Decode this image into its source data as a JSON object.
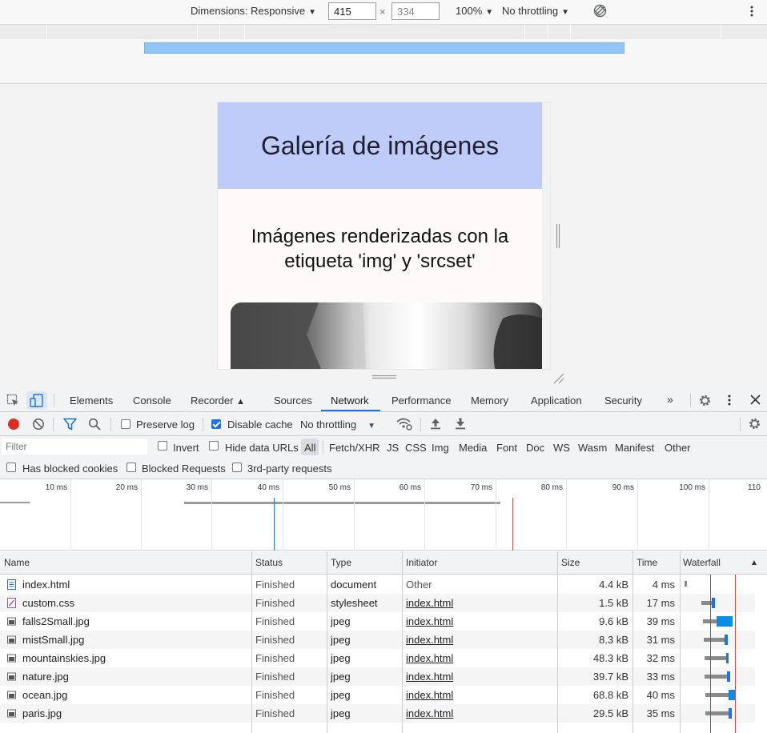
{
  "device_toolbar": {
    "dimensions_label": "Dimensions: Responsive",
    "width_value": "415",
    "height_value": "334",
    "zoom_label": "100%",
    "throttle_label": "No throttling"
  },
  "page": {
    "title": "Galería de imágenes",
    "subtitle": "Imágenes renderizadas con la etiqueta 'img' y 'srcset'"
  },
  "devtools": {
    "tabs": [
      "Elements",
      "Console",
      "Recorder",
      "Sources",
      "Network",
      "Performance",
      "Memory",
      "Application",
      "Security"
    ],
    "active_tab": "Network",
    "toolbar": {
      "preserve_log": "Preserve log",
      "disable_cache": "Disable cache",
      "throttling": "No throttling"
    },
    "filter": {
      "placeholder": "Filter",
      "invert": "Invert",
      "hide_data_urls": "Hide data URLs",
      "types": [
        "All",
        "Fetch/XHR",
        "JS",
        "CSS",
        "Img",
        "Media",
        "Font",
        "Doc",
        "WS",
        "Wasm",
        "Manifest",
        "Other"
      ],
      "has_blocked_cookies": "Has blocked cookies",
      "blocked_requests": "Blocked Requests",
      "third_party": "3rd-party requests"
    },
    "overview_ticks": [
      "10 ms",
      "20 ms",
      "30 ms",
      "40 ms",
      "50 ms",
      "60 ms",
      "70 ms",
      "80 ms",
      "90 ms",
      "100 ms",
      "110"
    ],
    "columns": [
      "Name",
      "Status",
      "Type",
      "Initiator",
      "Size",
      "Time",
      "Waterfall"
    ],
    "rows": [
      {
        "name": "index.html",
        "status": "Finished",
        "type": "document",
        "initiator": "Other",
        "size": "4.4 kB",
        "time": "4 ms"
      },
      {
        "name": "custom.css",
        "status": "Finished",
        "type": "stylesheet",
        "initiator": "index.html",
        "size": "1.5 kB",
        "time": "17 ms"
      },
      {
        "name": "falls2Small.jpg",
        "status": "Finished",
        "type": "jpeg",
        "initiator": "index.html",
        "size": "9.6 kB",
        "time": "39 ms"
      },
      {
        "name": "mistSmall.jpg",
        "status": "Finished",
        "type": "jpeg",
        "initiator": "index.html",
        "size": "8.3 kB",
        "time": "31 ms"
      },
      {
        "name": "mountainskies.jpg",
        "status": "Finished",
        "type": "jpeg",
        "initiator": "index.html",
        "size": "48.3 kB",
        "time": "32 ms"
      },
      {
        "name": "nature.jpg",
        "status": "Finished",
        "type": "jpeg",
        "initiator": "index.html",
        "size": "39.7 kB",
        "time": "33 ms"
      },
      {
        "name": "ocean.jpg",
        "status": "Finished",
        "type": "jpeg",
        "initiator": "index.html",
        "size": "68.8 kB",
        "time": "40 ms"
      },
      {
        "name": "paris.jpg",
        "status": "Finished",
        "type": "jpeg",
        "initiator": "index.html",
        "size": "29.5 kB",
        "time": "35 ms"
      }
    ]
  },
  "colors": {
    "header_bg": "#bfcbf8",
    "accent": "#1a73e8",
    "record": "#d93025",
    "load_line": "#d14b4b"
  }
}
